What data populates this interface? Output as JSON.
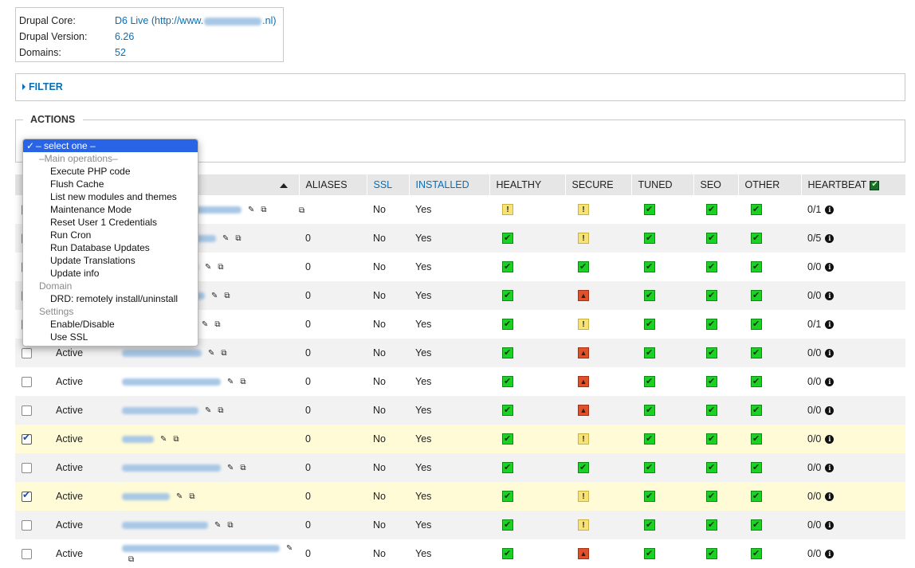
{
  "info": {
    "core_label": "Drupal Core:",
    "core_value": "D6 Live",
    "core_url_prefix": "(http://www.",
    "core_url_suffix": ".nl)",
    "version_label": "Drupal Version:",
    "version_value": "6.26",
    "domains_label": "Domains:",
    "domains_value": "52"
  },
  "filter": {
    "label": "FILTER"
  },
  "actions": {
    "label": "ACTIONS",
    "dropdown": {
      "selected": "– select one –",
      "groups": [
        {
          "label": "–Main operations–",
          "options": [
            "Execute PHP code",
            "Flush Cache",
            "List new modules and themes",
            "Maintenance Mode",
            "Reset User 1 Credentials",
            "Run Cron",
            "Run Database Updates",
            "Update Translations",
            "Update info"
          ]
        },
        {
          "label": "Domain",
          "options": [
            "DRD: remotely install/uninstall"
          ]
        },
        {
          "label": "Settings",
          "options": [
            "Enable/Disable",
            "Use SSL"
          ]
        }
      ]
    }
  },
  "table": {
    "headers": {
      "aliases": "ALIASES",
      "ssl": "SSL",
      "installed": "INSTALLED",
      "healthy": "HEALTHY",
      "secure": "SECURE",
      "tuned": "TUNED",
      "seo": "SEO",
      "other": "OTHER",
      "heartbeat": "HEARTBEAT"
    },
    "colors": {
      "ok": "#1bd124",
      "warning": "#f7e27a",
      "critical": "#e0512b",
      "link": "#0a6eb4",
      "selected_row": "#fffbd6"
    },
    "rows": [
      {
        "checked": false,
        "status": "",
        "aliases": "",
        "ssl": "No",
        "installed": "Yes",
        "healthy": "warning",
        "secure": "warning",
        "tuned": "ok",
        "seo": "ok",
        "other": "ok",
        "heartbeat": "0/1"
      },
      {
        "checked": false,
        "status": "",
        "aliases": "0",
        "ssl": "No",
        "installed": "Yes",
        "healthy": "ok",
        "secure": "warning",
        "tuned": "ok",
        "seo": "ok",
        "other": "ok",
        "heartbeat": "0/5"
      },
      {
        "checked": false,
        "status": "",
        "aliases": "0",
        "ssl": "No",
        "installed": "Yes",
        "healthy": "ok",
        "secure": "ok",
        "tuned": "ok",
        "seo": "ok",
        "other": "ok",
        "heartbeat": "0/0"
      },
      {
        "checked": false,
        "status": "",
        "aliases": "0",
        "ssl": "No",
        "installed": "Yes",
        "healthy": "ok",
        "secure": "critical",
        "tuned": "ok",
        "seo": "ok",
        "other": "ok",
        "heartbeat": "0/0"
      },
      {
        "checked": false,
        "status": "",
        "aliases": "0",
        "ssl": "No",
        "installed": "Yes",
        "healthy": "ok",
        "secure": "warning",
        "tuned": "ok",
        "seo": "ok",
        "other": "ok",
        "heartbeat": "0/1"
      },
      {
        "checked": false,
        "status": "Active",
        "aliases": "0",
        "ssl": "No",
        "installed": "Yes",
        "healthy": "ok",
        "secure": "critical",
        "tuned": "ok",
        "seo": "ok",
        "other": "ok",
        "heartbeat": "0/0"
      },
      {
        "checked": false,
        "status": "Active",
        "aliases": "0",
        "ssl": "No",
        "installed": "Yes",
        "healthy": "ok",
        "secure": "critical",
        "tuned": "ok",
        "seo": "ok",
        "other": "ok",
        "heartbeat": "0/0"
      },
      {
        "checked": false,
        "status": "Active",
        "aliases": "0",
        "ssl": "No",
        "installed": "Yes",
        "healthy": "ok",
        "secure": "critical",
        "tuned": "ok",
        "seo": "ok",
        "other": "ok",
        "heartbeat": "0/0"
      },
      {
        "checked": true,
        "status": "Active",
        "aliases": "0",
        "ssl": "No",
        "installed": "Yes",
        "healthy": "ok",
        "secure": "warning",
        "tuned": "ok",
        "seo": "ok",
        "other": "ok",
        "heartbeat": "0/0"
      },
      {
        "checked": false,
        "status": "Active",
        "aliases": "0",
        "ssl": "No",
        "installed": "Yes",
        "healthy": "ok",
        "secure": "ok",
        "tuned": "ok",
        "seo": "ok",
        "other": "ok",
        "heartbeat": "0/0"
      },
      {
        "checked": true,
        "status": "Active",
        "aliases": "0",
        "ssl": "No",
        "installed": "Yes",
        "healthy": "ok",
        "secure": "warning",
        "tuned": "ok",
        "seo": "ok",
        "other": "ok",
        "heartbeat": "0/0"
      },
      {
        "checked": false,
        "status": "Active",
        "aliases": "0",
        "ssl": "No",
        "installed": "Yes",
        "healthy": "ok",
        "secure": "warning",
        "tuned": "ok",
        "seo": "ok",
        "other": "ok",
        "heartbeat": "0/0"
      },
      {
        "checked": false,
        "status": "Active",
        "aliases": "0",
        "ssl": "No",
        "installed": "Yes",
        "healthy": "ok",
        "secure": "critical",
        "tuned": "ok",
        "seo": "ok",
        "other": "ok",
        "heartbeat": "0/0"
      }
    ]
  }
}
